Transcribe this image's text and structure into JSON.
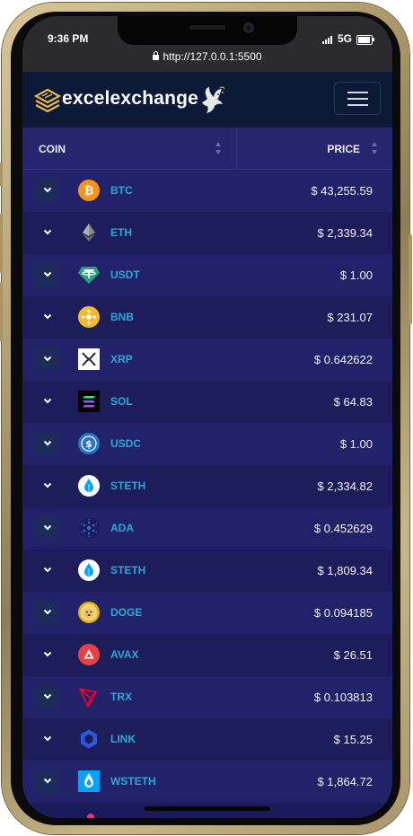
{
  "status_bar": {
    "time": "9:36 PM",
    "network": "5G",
    "battery_level": 0.9
  },
  "browser": {
    "url": "http://127.0.0.1:5500"
  },
  "header": {
    "brand": "excelexchange",
    "logo_icon": "layers-logo-icon",
    "mascot_icon": "dove-icon",
    "menu_icon": "hamburger-menu-icon"
  },
  "table": {
    "columns": [
      "COIN",
      "PRICE"
    ],
    "rows": [
      {
        "symbol": "BTC",
        "price": "$ 43,255.59",
        "icon": "bitcoin-icon"
      },
      {
        "symbol": "ETH",
        "price": "$ 2,339.34",
        "icon": "ethereum-icon"
      },
      {
        "symbol": "USDT",
        "price": "$ 1.00",
        "icon": "tether-icon"
      },
      {
        "symbol": "BNB",
        "price": "$ 231.07",
        "icon": "bnb-icon"
      },
      {
        "symbol": "XRP",
        "price": "$ 0.642622",
        "icon": "xrp-icon"
      },
      {
        "symbol": "SOL",
        "price": "$ 64.83",
        "icon": "solana-icon"
      },
      {
        "symbol": "USDC",
        "price": "$ 1.00",
        "icon": "usdc-icon"
      },
      {
        "symbol": "STETH",
        "price": "$ 2,334.82",
        "icon": "steth-icon"
      },
      {
        "symbol": "ADA",
        "price": "$ 0.452629",
        "icon": "cardano-icon"
      },
      {
        "symbol": "STETH",
        "price": "$ 1,809.34",
        "icon": "steth-icon"
      },
      {
        "symbol": "DOGE",
        "price": "$ 0.094185",
        "icon": "dogecoin-icon"
      },
      {
        "symbol": "AVAX",
        "price": "$ 26.51",
        "icon": "avalanche-icon"
      },
      {
        "symbol": "TRX",
        "price": "$ 0.103813",
        "icon": "tron-icon"
      },
      {
        "symbol": "LINK",
        "price": "$ 15.25",
        "icon": "chainlink-icon"
      },
      {
        "symbol": "WSTETH",
        "price": "$ 1,864.72",
        "icon": "wsteth-icon"
      }
    ]
  },
  "colors": {
    "frame_gold": "#c8b688",
    "navbar": "#0c1a38",
    "table_header": "#26266e",
    "row_odd": "#22226a",
    "row_even": "#1d1d5c",
    "symbol_text": "#2ea7d6",
    "price_text": "#f2f2f7"
  }
}
